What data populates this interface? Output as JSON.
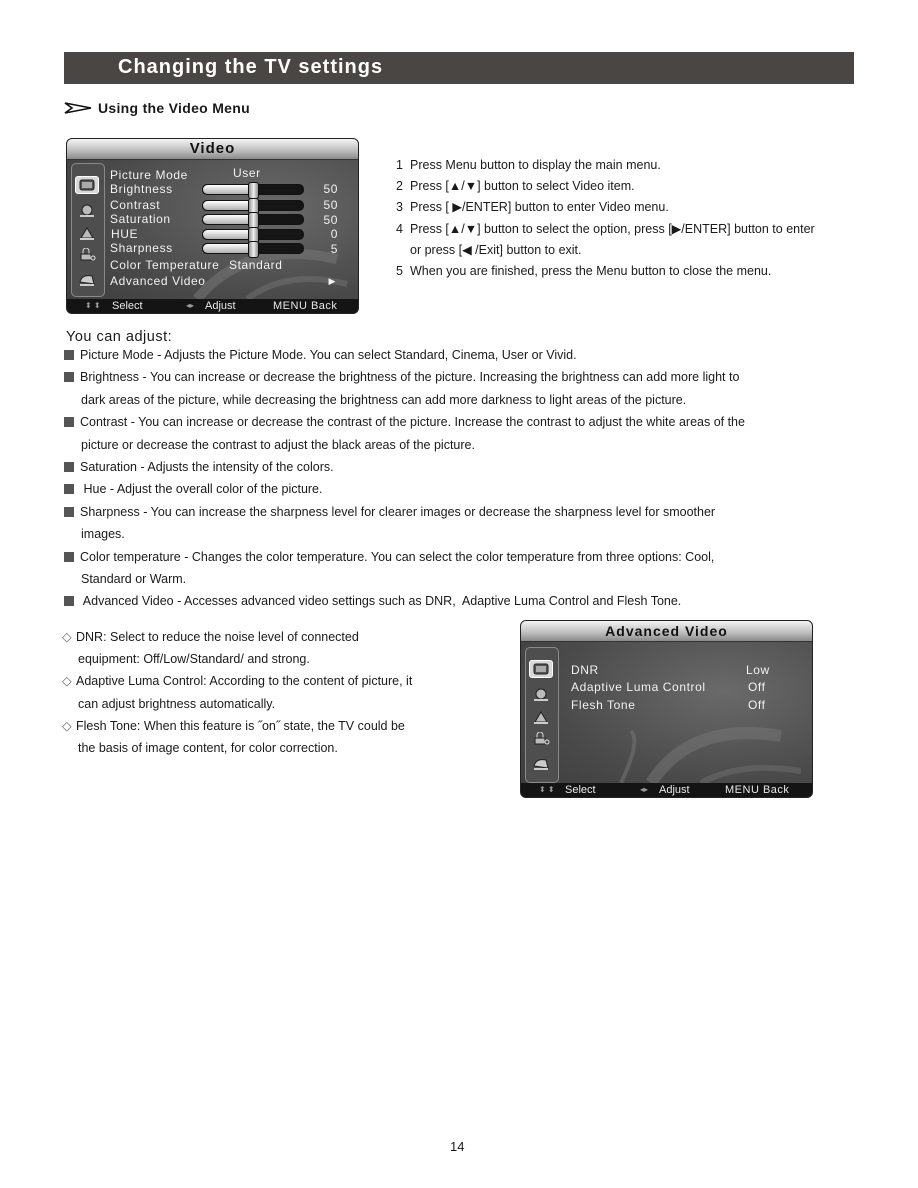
{
  "page": {
    "title": "Changing the TV settings",
    "section_heading": "Using the Video Menu",
    "page_number": "14"
  },
  "video_menu": {
    "title": "Video",
    "side_icons": [
      "tv-picture-icon",
      "sound-icon",
      "setup-icon",
      "lock-icon",
      "source-icon"
    ],
    "picture_mode": {
      "label": "Picture Mode",
      "value": "User"
    },
    "sliders": [
      {
        "label": "Brightness",
        "value": "50",
        "position": 0.5
      },
      {
        "label": "Contrast",
        "value": "50",
        "position": 0.5
      },
      {
        "label": "Saturation",
        "value": "50",
        "position": 0.5
      },
      {
        "label": "HUE",
        "value": "0",
        "position": 0.5
      },
      {
        "label": "Sharpness",
        "value": "5",
        "position": 0.5
      }
    ],
    "color_temperature": {
      "label": "Color Temperature",
      "value": "Standard"
    },
    "advanced_video": {
      "label": "Advanced Video",
      "arrow": "▶"
    },
    "footer": {
      "select": "Select",
      "adjust": "Adjust",
      "back": "MENU Back"
    }
  },
  "steps": [
    {
      "num": "1",
      "text": "Press Menu button to display the main menu."
    },
    {
      "num": "2",
      "text": "Press [▲/▼] button to select Video item."
    },
    {
      "num": "3",
      "text": "Press [ ▶/ENTER] button to enter Video menu."
    },
    {
      "num": "4",
      "text": "Press [▲/▼] button to select the option, press [▶/ENTER] button to enter"
    },
    {
      "num": "",
      "text": "or press [◀ /Exit] button to exit."
    },
    {
      "num": "5",
      "text": "When you are finished, press the Menu button to close the menu."
    }
  ],
  "adjust": {
    "heading": "You can adjust:",
    "items": [
      {
        "lines": [
          "Picture Mode - Adjusts the Picture Mode.  You can select   Standard,  Cinema,  User or Vivid."
        ]
      },
      {
        "lines": [
          "Brightness - You can increase or decrease the brightness of the picture.  Increasing the brightness can add more light to",
          "dark areas of the picture,  while decreasing the brightness can add more darkness to light areas of the picture."
        ]
      },
      {
        "lines": [
          "Contrast - You can increase or decrease the contrast of the picture.  Increase the contrast to adjust the white areas of the",
          "picture or decrease the contrast to adjust the black areas of the picture."
        ]
      },
      {
        "lines": [
          "Saturation - Adjusts the intensity of the colors."
        ]
      },
      {
        "lines": [
          " Hue - Adjust the overall color of the picture."
        ]
      },
      {
        "lines": [
          "Sharpness - You can increase the sharpness level for clearer images or decrease the sharpness level for smoother",
          "images."
        ]
      },
      {
        "lines": [
          "Color temperature - Changes the color temperature.  You can select the color temperature from three options: Cool,",
          "Standard or Warm."
        ]
      },
      {
        "lines": [
          " Advanced Video - Accesses advanced video settings such as DNR,  Adaptive Luma Control and Flesh Tone."
        ]
      }
    ]
  },
  "advanced_notes": [
    {
      "lines": [
        "DNR:  Select to reduce the noise level of connected",
        "equipment: Off/Low/Standard/ and strong."
      ]
    },
    {
      "lines": [
        "Adaptive Luma Control:  According to the content of picture,  it",
        "can adjust brightness automatically."
      ]
    },
    {
      "lines": [
        "Flesh Tone:  When this feature is ˝on˝ state,  the TV could be",
        "the basis of image content,  for color correction."
      ]
    }
  ],
  "advanced_menu": {
    "title": "Advanced Video",
    "items": [
      {
        "label": "DNR",
        "value": "Low"
      },
      {
        "label": "Adaptive Luma Control",
        "value": "Off"
      },
      {
        "label": "Flesh Tone",
        "value": "Off"
      }
    ],
    "footer": {
      "select": "Select",
      "adjust": "Adjust",
      "back": "MENU Back"
    }
  }
}
